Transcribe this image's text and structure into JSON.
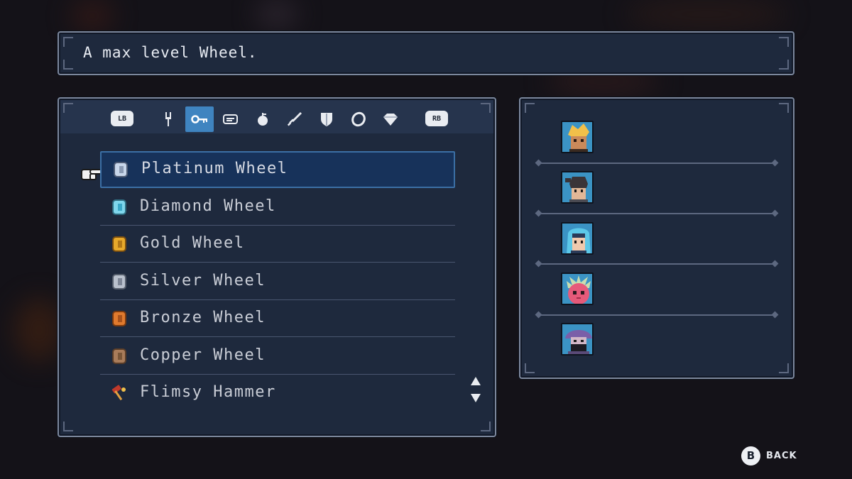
{
  "description": "A max level Wheel.",
  "tabs": {
    "left_shoulder": "LB",
    "right_shoulder": "RB",
    "items": [
      {
        "icon": "fork-icon",
        "active": false
      },
      {
        "icon": "key-icon",
        "active": true
      },
      {
        "icon": "scroll-icon",
        "active": false
      },
      {
        "icon": "apple-icon",
        "active": false
      },
      {
        "icon": "sword-icon",
        "active": false
      },
      {
        "icon": "shield-icon",
        "active": false
      },
      {
        "icon": "ring-icon",
        "active": false
      },
      {
        "icon": "diamond-icon",
        "active": false
      }
    ]
  },
  "items": [
    {
      "label": "Platinum Wheel",
      "icon": "platinum-wheel-icon",
      "color": "#c8d6ea",
      "selected": true
    },
    {
      "label": "Diamond Wheel",
      "icon": "diamond-wheel-icon",
      "color": "#7fd6ec",
      "selected": false
    },
    {
      "label": "Gold Wheel",
      "icon": "gold-wheel-icon",
      "color": "#e7a92b",
      "selected": false
    },
    {
      "label": "Silver Wheel",
      "icon": "silver-wheel-icon",
      "color": "#b9c0cc",
      "selected": false
    },
    {
      "label": "Bronze Wheel",
      "icon": "bronze-wheel-icon",
      "color": "#e07a2e",
      "selected": false
    },
    {
      "label": "Copper Wheel",
      "icon": "copper-wheel-icon",
      "color": "#a97c5a",
      "selected": false
    },
    {
      "label": "Flimsy Hammer",
      "icon": "hammer-icon",
      "color": "#c0392b",
      "selected": false
    }
  ],
  "party": [
    {
      "name": "blonde-hero-portrait",
      "hair": "#f1c04a",
      "skin": "#c98a5a",
      "bg": "#3b93c4"
    },
    {
      "name": "dark-hair-ponytail-portrait",
      "hair": "#3a3438",
      "skin": "#e2b797",
      "bg": "#3b93c4"
    },
    {
      "name": "blue-hood-portrait",
      "hair": "#5cc8e8",
      "skin": "#f0c9ad",
      "bg": "#3b93c4"
    },
    {
      "name": "pink-creature-portrait",
      "hair": "#e65a7a",
      "skin": "#f08aa0",
      "bg": "#3b93c4"
    },
    {
      "name": "purple-hat-portrait",
      "hair": "#7a5fa8",
      "skin": "#d2b8c8",
      "bg": "#3b93c4"
    }
  ],
  "back": {
    "button": "B",
    "label": "BACK"
  }
}
